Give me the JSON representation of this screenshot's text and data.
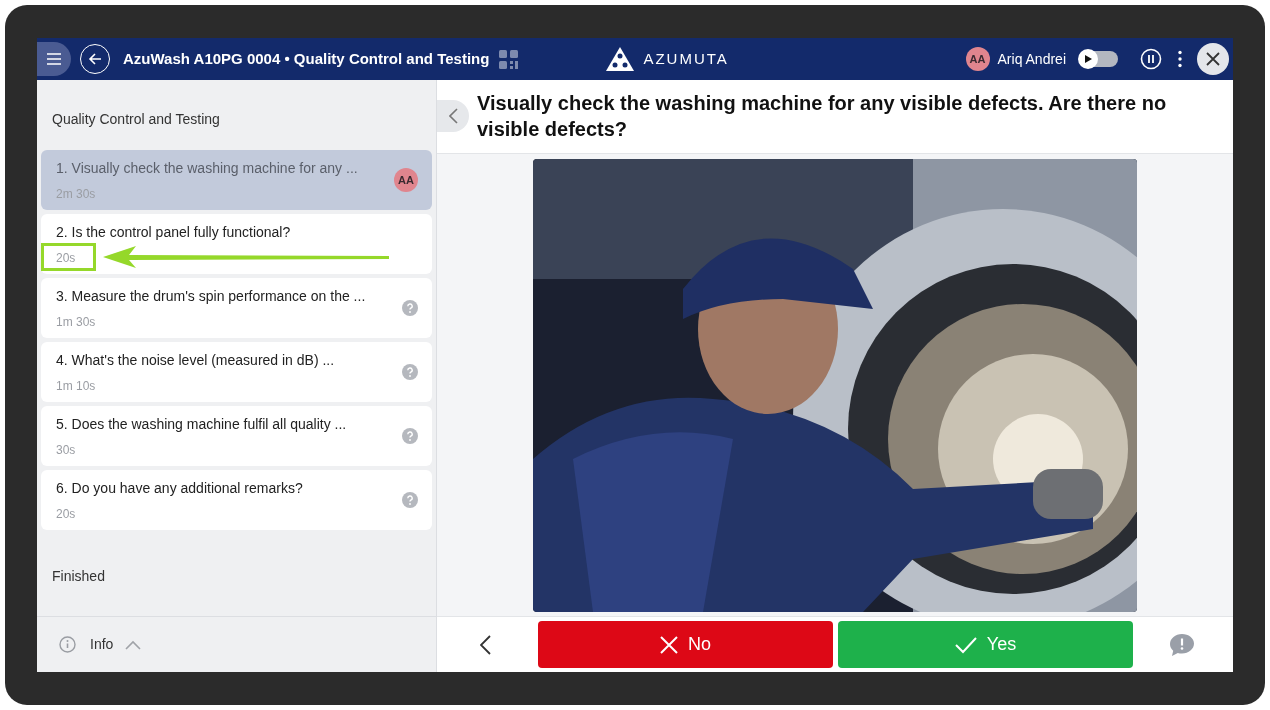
{
  "header": {
    "title": "AzuWash A10PG 0004 • Quality Control and Testing",
    "logo_text": "AZUMUTA",
    "user": {
      "initials": "AA",
      "name": "Ariq Andrei"
    },
    "autoplay": {
      "on": false
    }
  },
  "sidebar": {
    "section": "Quality Control and Testing",
    "steps": [
      {
        "title": "1. Visually check the washing machine for any ...",
        "time": "2m 30s",
        "selected": true,
        "highlighted": false,
        "status": {
          "kind": "avatar",
          "initials": "AA"
        }
      },
      {
        "title": "2. Is the control panel fully functional?",
        "time": "20s",
        "selected": false,
        "highlighted": true,
        "status": {
          "kind": "none"
        }
      },
      {
        "title": "3. Measure the drum's spin performance on the ...",
        "time": "1m 30s",
        "selected": false,
        "highlighted": false,
        "status": {
          "kind": "question"
        }
      },
      {
        "title": "4. What's the noise level (measured in dB) ...",
        "time": "1m 10s",
        "selected": false,
        "highlighted": false,
        "status": {
          "kind": "question"
        }
      },
      {
        "title": "5. Does the washing machine fulfil all quality ...",
        "time": "30s",
        "selected": false,
        "highlighted": false,
        "status": {
          "kind": "question"
        }
      },
      {
        "title": "6. Do you have any additional remarks?",
        "time": "20s",
        "selected": false,
        "highlighted": false,
        "status": {
          "kind": "question"
        }
      }
    ],
    "finished": "Finished",
    "info": {
      "label": "Info",
      "expanded": false
    }
  },
  "question": {
    "text": "Visually check the washing machine for any visible defects. Are there no visible defects?"
  },
  "answers": [
    {
      "label": "No",
      "kind": "no"
    },
    {
      "label": "Yes",
      "kind": "yes"
    }
  ]
}
